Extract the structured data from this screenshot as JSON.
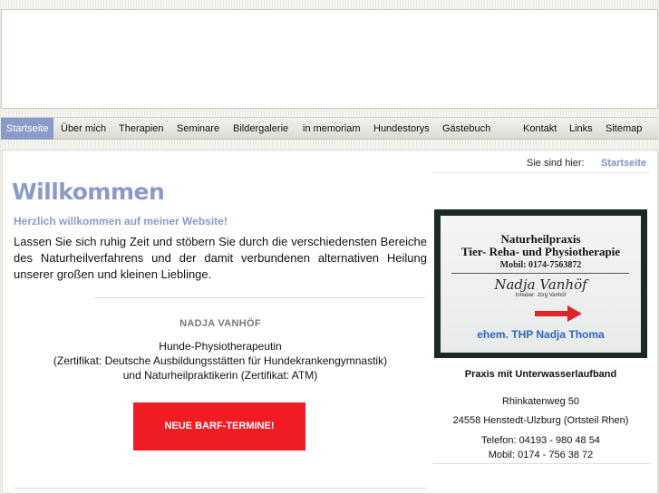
{
  "nav": {
    "items": [
      {
        "label": "Startseite",
        "active": true
      },
      {
        "label": "Über mich"
      },
      {
        "label": "Therapien"
      },
      {
        "label": "Seminare"
      },
      {
        "label": "Bildergalerie"
      },
      {
        "label": "in memoriam"
      },
      {
        "label": "Hundestorys"
      },
      {
        "label": "Gästebuch"
      },
      {
        "label": "Kontakt"
      },
      {
        "label": "Links"
      },
      {
        "label": "Sitemap"
      }
    ]
  },
  "breadcrumb": {
    "label": "Sie sind hier:",
    "current": "Startseite"
  },
  "main": {
    "title": "Willkommen",
    "subtitle": "Herzlich willkommen auf meiner Website!",
    "intro": "Lassen Sie sich ruhig Zeit und stöbern Sie durch die verschiedensten Bereiche des Naturheilverfahrens und der damit verbundenen alternativen Heilung unserer großen und kleinen Lieblinge.",
    "owner_name": "NADJA VANHÖF",
    "owner_lines": [
      "Hunde-Physiotherapeutin",
      "(Zertifikat: Deutsche Ausbildungsstätten für Hundekrankengymnastik)",
      "und Naturheilpraktikerin (Zertifikat: ATM)"
    ],
    "barf_button": "NEUE BARF-TERMINE!"
  },
  "sidebar": {
    "photo": {
      "line1": "Naturheilpraxis",
      "line2": "Tier- Reha- und Physiotherapie",
      "phone": "Mobil: 0174-7563872",
      "signature": "Nadja Vanhöf",
      "inhaber": "Inhaber: Jörg Vanhöf",
      "overlay": "ehem. THP Nadja Thoma"
    },
    "practice_name": "Praxis mit Unterwasserlaufband",
    "street": "Rhinkatenweg 50",
    "city": "24558 Henstedt-Ulzburg (Ortsteil Rhen)",
    "phone": "Telefon: 04193 - 980 48 54",
    "mobile": "Mobil: 0174 - 756 38 72"
  },
  "colors": {
    "accent": "#8a9bc9",
    "button_red": "#ef1c24",
    "arrow_red": "#d9262b",
    "overlay_blue": "#2e67c5"
  }
}
